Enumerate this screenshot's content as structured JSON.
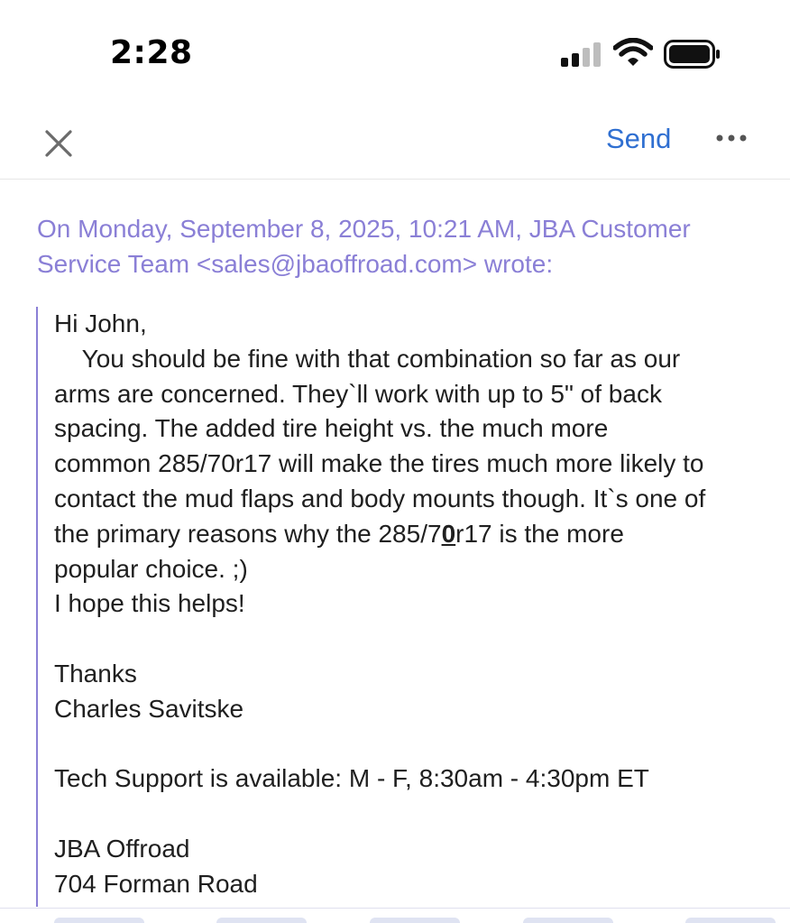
{
  "status_bar": {
    "time": "2:28"
  },
  "toolbar": {
    "close_icon": "close-icon",
    "send_label": "Send",
    "more_icon": "more-horizontal-icon",
    "accent_color": "#2f6fd1"
  },
  "quote": {
    "header_line1": "On Monday, September 8, 2025, 10:21 AM, JBA Customer",
    "header_line2": "Service Team <sales@jbaoffroad.com> wrote:",
    "accent_color": "#8a7fd6",
    "greeting": "Hi John,",
    "para_line1": "    You should be fine with that combination so far as our",
    "para_line2": "arms are concerned. They`ll work with up to 5\" of back",
    "para_line3": "spacing. The added tire height vs. the much more",
    "para_line4": "common 285/70r17 will make the tires much more likely to",
    "para_line5": "contact the mud flaps and body mounts though. It`s one of",
    "para_line6_a": "the primary reasons why the 285/7",
    "para_line6_b": "0",
    "para_line6_c": "r17 is the more",
    "para_line7": "popular choice. ;)",
    "closing_line": "I hope this helps!",
    "thanks": "Thanks",
    "signature_name": "Charles Savitske",
    "support_hours": "Tech Support is available: M - F, 8:30am - 4:30pm ET",
    "company": "JBA Offroad",
    "address": "704 Forman Road"
  }
}
